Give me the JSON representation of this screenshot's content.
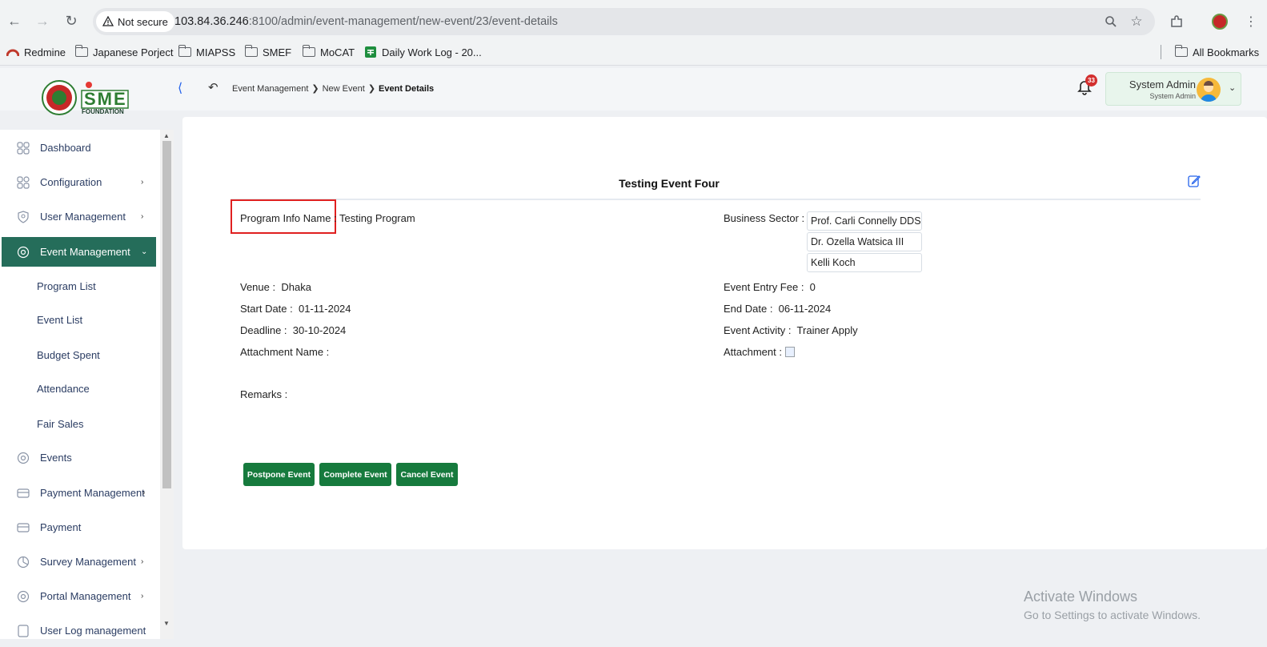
{
  "browser": {
    "security_label": "Not secure",
    "url_host": "103.84.36.246",
    "url_path": ":8100/admin/event-management/new-event/23/event-details",
    "bookmarks": [
      "Redmine",
      "Japanese Porject",
      "MIAPSS",
      "SMEF",
      "MoCAT",
      "Daily Work Log - 20..."
    ],
    "all_bookmarks": "All Bookmarks"
  },
  "header": {
    "logo_text": "FOUNDATION",
    "logo_letters": "SME",
    "breadcrumb": [
      "Event Management",
      "New Event",
      "Event Details"
    ],
    "notification_count": "33",
    "user_name": "System Admin",
    "user_role": "System Admin"
  },
  "sidebar": {
    "items": [
      {
        "label": "Dashboard",
        "icon": "grid-icon"
      },
      {
        "label": "Configuration",
        "icon": "config-icon"
      },
      {
        "label": "User Management",
        "icon": "user-shield-icon"
      },
      {
        "label": "Event Management",
        "icon": "event-icon"
      },
      {
        "label": "Events",
        "icon": "event-icon"
      },
      {
        "label": "Payment Management",
        "icon": "payment-icon"
      },
      {
        "label": "Payment",
        "icon": "payment-icon"
      },
      {
        "label": "Survey Management",
        "icon": "pie-icon"
      },
      {
        "label": "Portal Management",
        "icon": "portal-icon"
      },
      {
        "label": "User Log management",
        "icon": "log-icon"
      }
    ],
    "sub_items": [
      "Program List",
      "Event List",
      "Budget Spent",
      "Attendance",
      "Fair Sales"
    ]
  },
  "event": {
    "title": "Testing Event Four",
    "program_label": "Program Info Name :",
    "program_value": "Testing Program",
    "sector_label": "Business Sector :",
    "sectors": [
      "Prof. Carli Connelly DDS",
      "Dr. Ozella Watsica III",
      "Kelli Koch"
    ],
    "venue_label": "Venue :",
    "venue_value": "Dhaka",
    "fee_label": "Event Entry Fee :",
    "fee_value": "0",
    "start_label": "Start Date :",
    "start_value": "01-11-2024",
    "end_label": "End Date :",
    "end_value": "06-11-2024",
    "deadline_label": "Deadline :",
    "deadline_value": "30-10-2024",
    "activity_label": "Event Activity :",
    "activity_value": "Trainer Apply",
    "attachment_name_label": "Attachment Name :",
    "attachment_label": "Attachment :",
    "remarks_label": "Remarks :"
  },
  "actions": {
    "postpone": "Postpone Event",
    "complete": "Complete Event",
    "cancel": "Cancel Event"
  },
  "watermark": {
    "line1": "Activate Windows",
    "line2": "Go to Settings to activate Windows."
  },
  "colors": {
    "sidebar_active": "#256d5a",
    "button_green": "#167a3d",
    "highlight_red": "#e02020"
  }
}
